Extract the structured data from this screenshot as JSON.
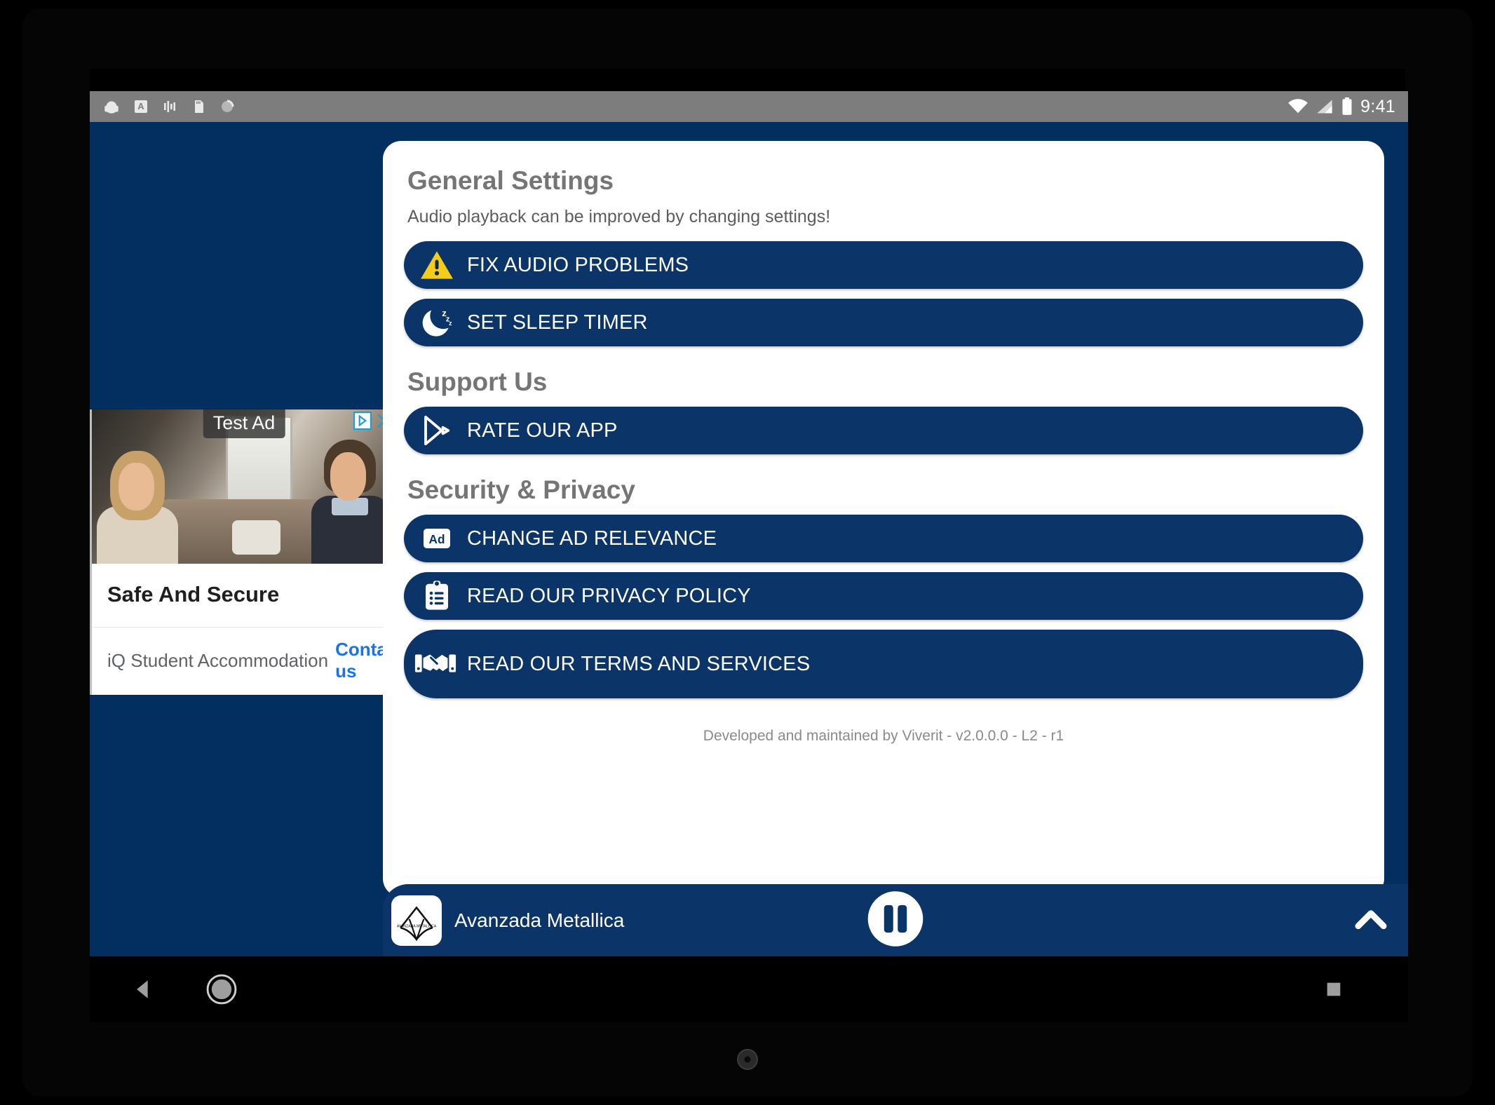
{
  "status_bar": {
    "time": "9:41",
    "left_icons": [
      "headphones-icon",
      "font-size-icon",
      "equalizer-icon",
      "sd-card-icon",
      "sync-icon"
    ],
    "right_icons": [
      "wifi-icon",
      "cell-signal-icon",
      "battery-icon"
    ]
  },
  "app": {
    "background_color": "#032e60",
    "accent_color": "#0b3568",
    "close_label": "close-screen"
  },
  "settings": {
    "sections": [
      {
        "title": "General Settings",
        "subtitle": "Audio playback can be improved by changing settings!",
        "buttons": [
          {
            "icon": "warning-triangle-icon",
            "label": "FIX AUDIO PROBLEMS"
          },
          {
            "icon": "sleep-moon-icon",
            "label": "SET SLEEP TIMER"
          }
        ]
      },
      {
        "title": "Support Us",
        "subtitle": "",
        "buttons": [
          {
            "icon": "google-play-icon",
            "label": "RATE OUR APP"
          }
        ]
      },
      {
        "title": "Security & Privacy",
        "subtitle": "",
        "buttons": [
          {
            "icon": "ad-badge-icon",
            "label": "CHANGE AD RELEVANCE"
          },
          {
            "icon": "clipboard-list-icon",
            "label": "READ OUR PRIVACY POLICY"
          },
          {
            "icon": "handshake-icon",
            "label": "READ OUR TERMS AND SERVICES"
          }
        ]
      }
    ],
    "footer_credit": "Developed and maintained by Viverit - v2.0.0.0 - L2 - r1"
  },
  "ad": {
    "badge": "Test Ad",
    "headline": "Safe And Secure",
    "advertiser": "iQ Student Accommodation",
    "cta": "Contact us",
    "choices_icon": "adchoices-icon",
    "close_icon": "ad-close-icon"
  },
  "player": {
    "station": "Avanzada Metallica",
    "transport_state": "pause-icon",
    "expand_icon": "chevron-up-icon"
  },
  "nav_bar": {
    "back": "back-triangle-icon",
    "home": "home-circle-icon",
    "recents": "recents-square-icon"
  }
}
